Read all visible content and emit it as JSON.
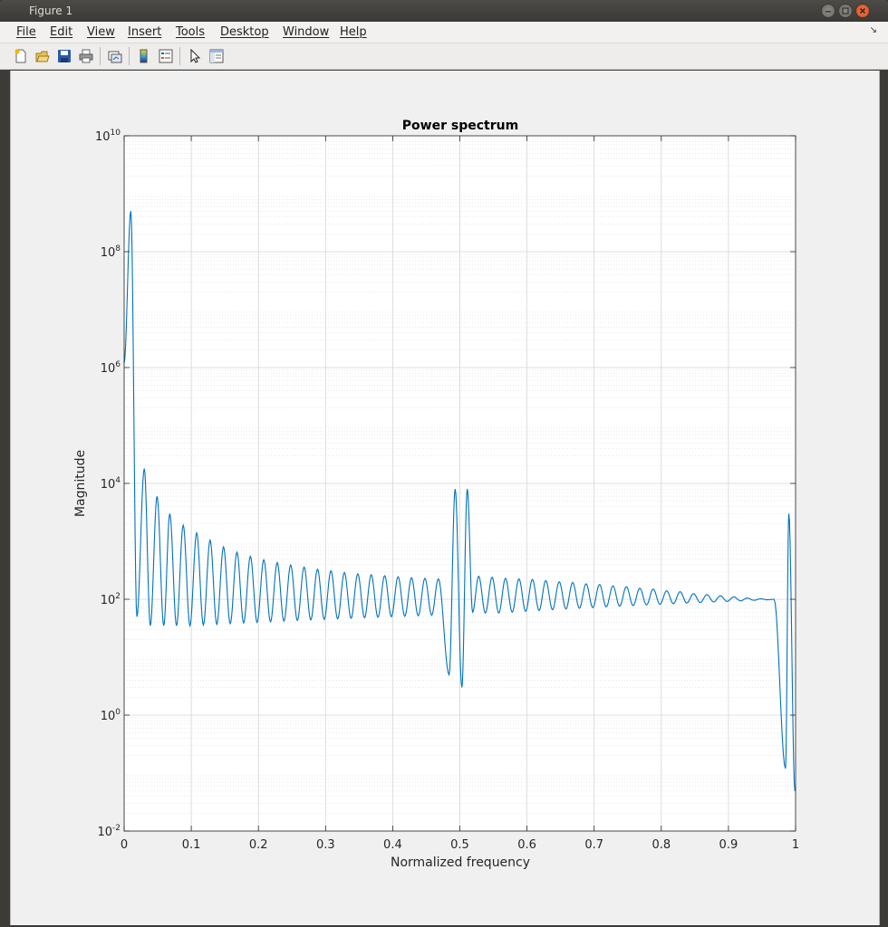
{
  "window": {
    "title": "Figure 1"
  },
  "menu": [
    "File",
    "Edit",
    "View",
    "Insert",
    "Tools",
    "Desktop",
    "Window",
    "Help"
  ],
  "toolbar": {
    "icons": [
      "new-figure-icon",
      "open-file-icon",
      "save-icon",
      "print-icon",
      "link-plot-icon",
      "colorbar-icon",
      "legend-icon",
      "pointer-icon",
      "property-editor-icon"
    ]
  },
  "colors": {
    "line": "#0072bd",
    "close_button": "#e0561f"
  },
  "chart_data": {
    "type": "line",
    "title": "Power spectrum",
    "xlabel": "Normalized frequency",
    "ylabel": "Magnitude",
    "xlim": [
      0,
      1
    ],
    "ylim": [
      0.01,
      10000000000
    ],
    "yscale": "log",
    "grid": "major and minor",
    "x_ticks": [
      "0",
      "0.1",
      "0.2",
      "0.3",
      "0.4",
      "0.5",
      "0.6",
      "0.7",
      "0.8",
      "0.9",
      "1"
    ],
    "y_ticks": [
      {
        "base": "10",
        "exp": "10"
      },
      {
        "base": "10",
        "exp": "8"
      },
      {
        "base": "10",
        "exp": "6"
      },
      {
        "base": "10",
        "exp": "4"
      },
      {
        "base": "10",
        "exp": "2"
      },
      {
        "base": "10",
        "exp": "0"
      },
      {
        "base": "10",
        "exp": "-2"
      }
    ],
    "series": [
      {
        "peaks": [
          [
            0.01,
            500000000
          ],
          [
            0.03,
            18000
          ],
          [
            0.049,
            6000
          ],
          [
            0.068,
            3000
          ],
          [
            0.088,
            1900
          ],
          [
            0.108,
            1400
          ],
          [
            0.128,
            1050
          ],
          [
            0.148,
            800
          ],
          [
            0.168,
            650
          ],
          [
            0.188,
            550
          ],
          [
            0.208,
            480
          ],
          [
            0.228,
            430
          ],
          [
            0.248,
            390
          ],
          [
            0.268,
            360
          ],
          [
            0.288,
            330
          ],
          [
            0.308,
            310
          ],
          [
            0.328,
            290
          ],
          [
            0.348,
            275
          ],
          [
            0.368,
            265
          ],
          [
            0.388,
            255
          ],
          [
            0.408,
            245
          ],
          [
            0.428,
            235
          ],
          [
            0.448,
            230
          ],
          [
            0.468,
            225
          ],
          [
            0.493,
            8000
          ],
          [
            0.511,
            8000
          ],
          [
            0.528,
            250
          ],
          [
            0.548,
            240
          ],
          [
            0.568,
            230
          ],
          [
            0.588,
            225
          ],
          [
            0.608,
            220
          ],
          [
            0.628,
            210
          ],
          [
            0.648,
            200
          ],
          [
            0.668,
            195
          ],
          [
            0.688,
            185
          ],
          [
            0.708,
            180
          ],
          [
            0.728,
            170
          ],
          [
            0.748,
            165
          ],
          [
            0.768,
            155
          ],
          [
            0.788,
            150
          ],
          [
            0.808,
            140
          ],
          [
            0.828,
            135
          ],
          [
            0.848,
            125
          ],
          [
            0.868,
            120
          ],
          [
            0.888,
            115
          ],
          [
            0.908,
            110
          ],
          [
            0.928,
            105
          ],
          [
            0.948,
            102
          ],
          [
            0.968,
            100
          ],
          [
            0.99,
            3000
          ]
        ],
        "troughs": [
          [
            0.019,
            50
          ],
          [
            0.039,
            35
          ],
          [
            0.059,
            35
          ],
          [
            0.078,
            35
          ],
          [
            0.098,
            35
          ],
          [
            0.118,
            36
          ],
          [
            0.138,
            37
          ],
          [
            0.158,
            38
          ],
          [
            0.178,
            39
          ],
          [
            0.198,
            40
          ],
          [
            0.218,
            41
          ],
          [
            0.238,
            42
          ],
          [
            0.258,
            43
          ],
          [
            0.278,
            44
          ],
          [
            0.298,
            45
          ],
          [
            0.318,
            46
          ],
          [
            0.338,
            47
          ],
          [
            0.358,
            48
          ],
          [
            0.378,
            49
          ],
          [
            0.398,
            50
          ],
          [
            0.418,
            51
          ],
          [
            0.438,
            52
          ],
          [
            0.458,
            53
          ],
          [
            0.484,
            5
          ],
          [
            0.503,
            3
          ],
          [
            0.519,
            60
          ],
          [
            0.538,
            58
          ],
          [
            0.558,
            58
          ],
          [
            0.578,
            60
          ],
          [
            0.598,
            62
          ],
          [
            0.618,
            64
          ],
          [
            0.638,
            66
          ],
          [
            0.658,
            68
          ],
          [
            0.678,
            70
          ],
          [
            0.698,
            72
          ],
          [
            0.718,
            74
          ],
          [
            0.738,
            76
          ],
          [
            0.758,
            78
          ],
          [
            0.778,
            80
          ],
          [
            0.798,
            82
          ],
          [
            0.818,
            84
          ],
          [
            0.838,
            86
          ],
          [
            0.858,
            88
          ],
          [
            0.878,
            90
          ],
          [
            0.898,
            92
          ],
          [
            0.918,
            94
          ],
          [
            0.938,
            96
          ],
          [
            0.958,
            98
          ],
          [
            0.985,
            0.12
          ],
          [
            0.999,
            0.05
          ]
        ]
      }
    ]
  }
}
